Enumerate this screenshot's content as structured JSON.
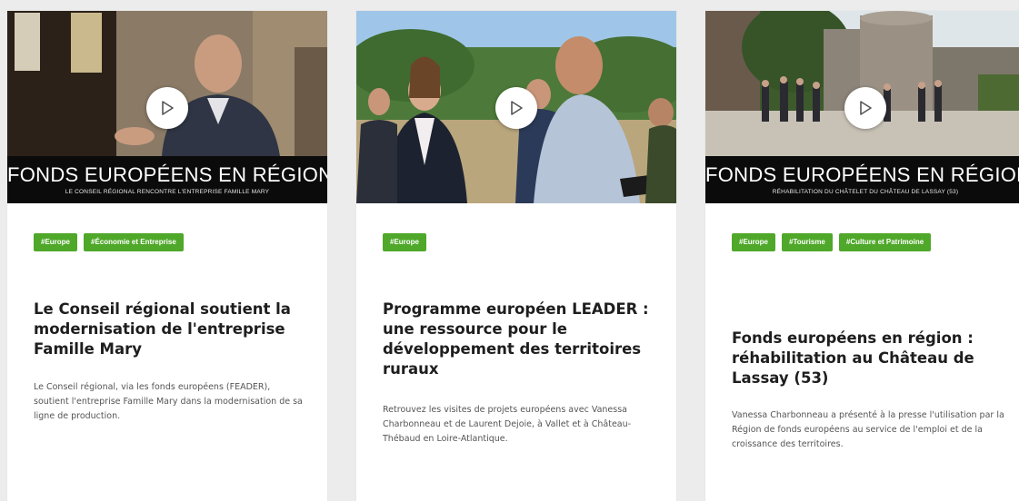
{
  "cards": [
    {
      "banner_title": "FONDS EUROPÉENS EN RÉGION",
      "banner_subtitle": "LE CONSEIL RÉGIONAL RENCONTRE L'ENTREPRISE FAMILLE MARY",
      "tags": [
        "#Europe",
        "#Économie et Entreprise"
      ],
      "title": "Le Conseil régional soutient la modernisation de l'entreprise Famille Mary",
      "description": "Le Conseil régional, via les fonds européens (FEADER), soutient l'entreprise Famille Mary dans la modernisation de sa ligne de production."
    },
    {
      "banner_title": "",
      "banner_subtitle": "",
      "tags": [
        "#Europe"
      ],
      "title": "Programme européen LEADER : une ressource pour le développement des territoires ruraux",
      "description": "Retrouvez les visites de projets européens avec Vanessa Charbonneau et de Laurent Dejoie, à Vallet et à Château-Thébaud en Loire-Atlantique."
    },
    {
      "banner_title": "FONDS EUROPÉENS EN RÉGION",
      "banner_subtitle": "RÉHABILITATION DU CHÂTELET DU CHÂTEAU DE LASSAY (53)",
      "tags": [
        "#Europe",
        "#Tourisme",
        "#Culture et Patrimoine"
      ],
      "title": "Fonds européens en région : réhabilitation au Château de Lassay (53)",
      "description": "Vanessa Charbonneau a présenté à la presse l'utilisation par la Région de fonds européens au service de l'emploi et de la croissance des territoires."
    }
  ],
  "icons": {
    "play": "play-icon"
  },
  "colors": {
    "tag_bg": "#4fa82a",
    "banner_bg": "#0b0b0b",
    "page_bg": "#ececec"
  }
}
